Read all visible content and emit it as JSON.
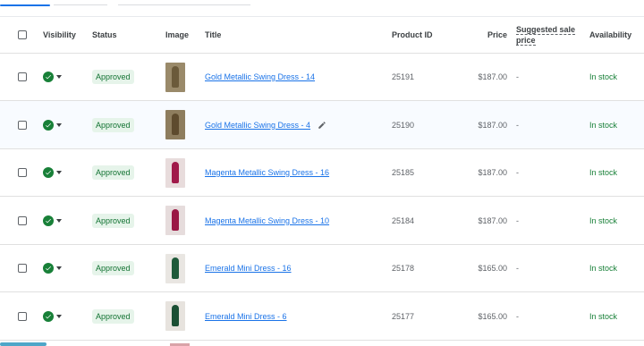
{
  "columns": {
    "visibility": "Visibility",
    "status": "Status",
    "image": "Image",
    "title": "Title",
    "product_id": "Product ID",
    "price": "Price",
    "suggested_sale_line1": "Suggested sale",
    "suggested_sale_line2": "price",
    "availability": "Availability"
  },
  "rows": [
    {
      "status": "Approved",
      "title": "Gold Metallic Swing Dress - 14",
      "product_id": "25191",
      "price": "$187.00",
      "sale": "-",
      "availability": "In stock",
      "thumb_bg": "#9a8a6a",
      "thumb_fg": "#6b5a3a"
    },
    {
      "status": "Approved",
      "title": "Gold Metallic Swing Dress - 4",
      "product_id": "25190",
      "price": "$187.00",
      "sale": "-",
      "availability": "In stock",
      "thumb_bg": "#8e7d5e",
      "thumb_fg": "#5e4b2e"
    },
    {
      "status": "Approved",
      "title": "Magenta Metallic Swing Dress - 16",
      "product_id": "25185",
      "price": "$187.00",
      "sale": "-",
      "availability": "In stock",
      "thumb_bg": "#e8dcdc",
      "thumb_fg": "#a01a4a"
    },
    {
      "status": "Approved",
      "title": "Magenta Metallic Swing Dress - 10",
      "product_id": "25184",
      "price": "$187.00",
      "sale": "-",
      "availability": "In stock",
      "thumb_bg": "#e6dcdc",
      "thumb_fg": "#9a1845"
    },
    {
      "status": "Approved",
      "title": "Emerald Mini Dress - 16",
      "product_id": "25178",
      "price": "$165.00",
      "sale": "-",
      "availability": "In stock",
      "thumb_bg": "#e9e6e2",
      "thumb_fg": "#1e5a3a"
    },
    {
      "status": "Approved",
      "title": "Emerald Mini Dress - 6",
      "product_id": "25177",
      "price": "$165.00",
      "sale": "-",
      "availability": "In stock",
      "thumb_bg": "#e7e3de",
      "thumb_fg": "#1b4f34"
    }
  ],
  "colors": {
    "accent": "#1a73e8",
    "approved_bg": "#e6f4ea",
    "approved_text": "#137333",
    "in_stock": "#188038"
  }
}
